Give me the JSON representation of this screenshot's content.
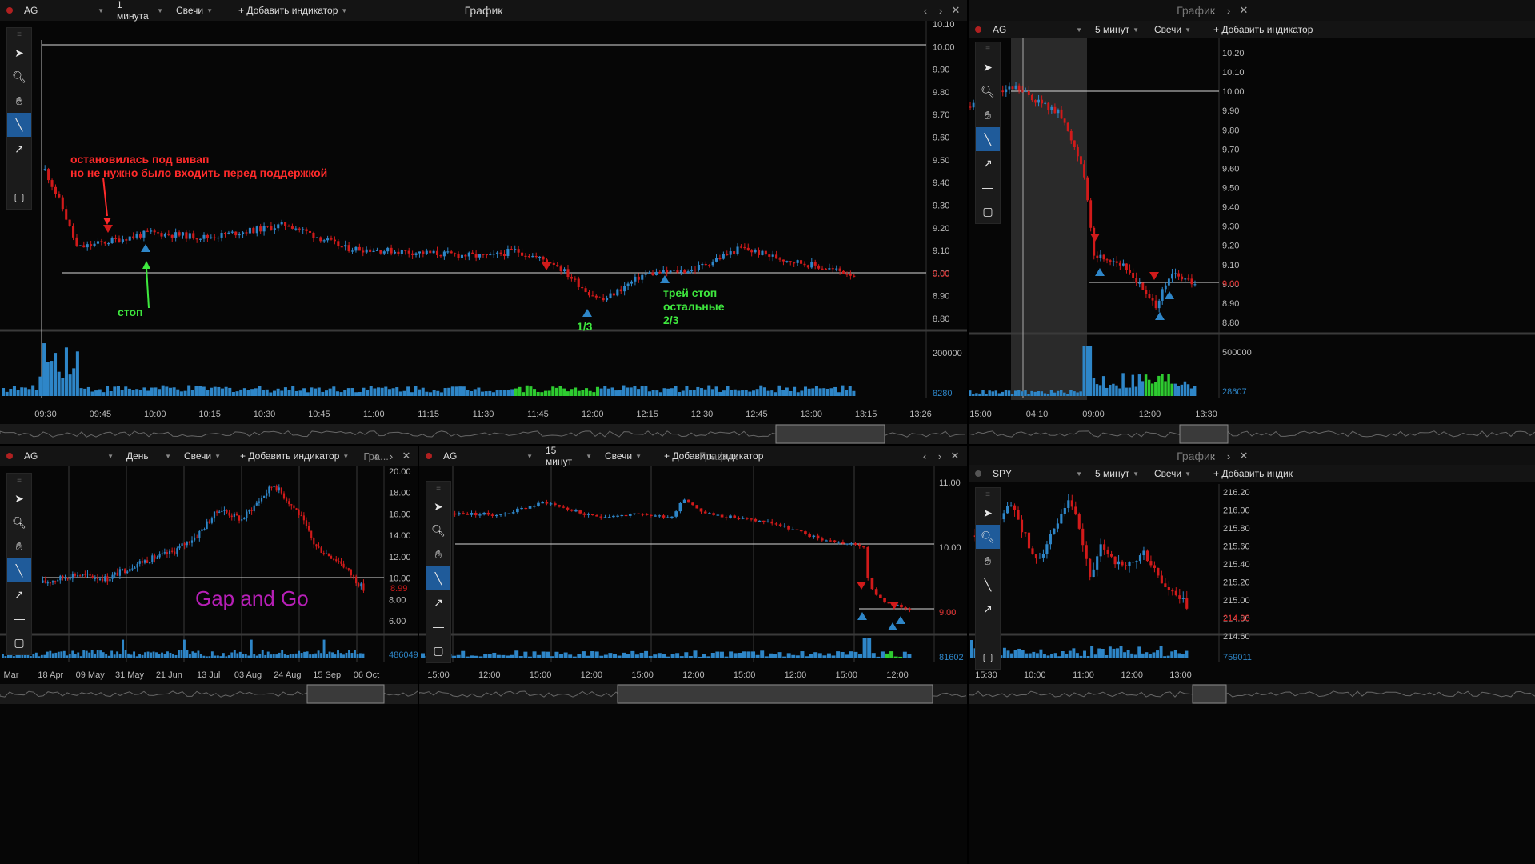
{
  "colors": {
    "up": "#2e86c8",
    "down": "#d11a1a",
    "green": "#2ecc30",
    "annot_red": "#ff2b2b",
    "annot_green": "#3ee83e",
    "magenta": "#b61fb6",
    "line": "#d8d8d8",
    "bg": "#060606"
  },
  "toolbar_icons": [
    "cursor-icon",
    "zoom-icon",
    "hand-icon",
    "line-icon",
    "arrow-icon",
    "hline-icon",
    "rect-icon"
  ],
  "panels": {
    "main": {
      "symbol": "AG",
      "timeframe": "1 минута",
      "chart_type": "Свечи",
      "add_indicator": "+ Добавить индикатор",
      "title": "График",
      "y_ticks": [
        "10.10",
        "10.00",
        "9.90",
        "9.80",
        "9.70",
        "9.60",
        "9.50",
        "9.40",
        "9.30",
        "9.20",
        "9.10",
        "9.00",
        "8.90",
        "8.80"
      ],
      "price_label": "9.00",
      "vol_ticks": [
        "200000",
        "8280"
      ],
      "x_ticks": [
        "09:30",
        "09:45",
        "10:00",
        "10:15",
        "10:30",
        "10:45",
        "11:00",
        "11:15",
        "11:30",
        "11:45",
        "12:00",
        "12:15",
        "12:30",
        "12:45",
        "13:00",
        "13:15",
        "13:26"
      ],
      "annot1": "остановилась под вивап\nно не нужно было входить перед поддержкой",
      "annot_stop": "стоп",
      "annot_third": "1/3",
      "annot_trail": "трей стоп\nостальные\n2/3"
    },
    "topright": {
      "symbol": "AG",
      "timeframe": "5 минут",
      "chart_type": "Свечи",
      "add_indicator": "+ Добавить индикатор",
      "title": "График",
      "y_ticks": [
        "10.20",
        "10.10",
        "10.00",
        "9.90",
        "9.80",
        "9.70",
        "9.60",
        "9.50",
        "9.40",
        "9.30",
        "9.20",
        "9.10",
        "9.00",
        "8.90",
        "8.80"
      ],
      "price_label": "9.00",
      "vol_ticks": [
        "500000",
        "28607"
      ],
      "x_ticks": [
        "15:00",
        "04:10",
        "09:00",
        "12:00",
        "13:30"
      ]
    },
    "daily": {
      "symbol": "AG",
      "timeframe": "День",
      "chart_type": "Свечи",
      "add_indicator": "+ Добавить индикатор",
      "title": "Гра...",
      "y_ticks": [
        "20.00",
        "18.00",
        "16.00",
        "14.00",
        "12.00",
        "10.00",
        "8.00",
        "6.00"
      ],
      "price_label": "8.99",
      "vol_ticks": [
        "4860494"
      ],
      "x_ticks": [
        "Mar",
        "18 Apr",
        "09 May",
        "31 May",
        "21 Jun",
        "13 Jul",
        "03 Aug",
        "24 Aug",
        "15 Sep",
        "06 Oct"
      ],
      "annot": "Gap and Go"
    },
    "fifteen": {
      "symbol": "AG",
      "timeframe": "15 минут",
      "chart_type": "Свечи",
      "add_indicator": "+ Добавить индикатор",
      "title": "График",
      "y_ticks": [
        "11.00",
        "10.00",
        "9.00"
      ],
      "price_label": "9.00",
      "vol_ticks": [
        "81602"
      ],
      "x_ticks": [
        "15:00",
        "12:00",
        "15:00",
        "12:00",
        "15:00",
        "12:00",
        "15:00",
        "12:00",
        "15:00",
        "12:00"
      ]
    },
    "spy": {
      "symbol": "SPY",
      "timeframe": "5 минут",
      "chart_type": "Свечи",
      "add_indicator": "+ Добавить индик",
      "title": "График",
      "y_ticks": [
        "216.20",
        "216.00",
        "215.80",
        "215.60",
        "215.40",
        "215.20",
        "215.00",
        "214.80",
        "214.60"
      ],
      "price_label": "214.93",
      "vol_ticks": [
        "759011"
      ],
      "x_ticks": [
        "15:30",
        "10:00",
        "11:00",
        "12:00",
        "13:00"
      ]
    }
  }
}
